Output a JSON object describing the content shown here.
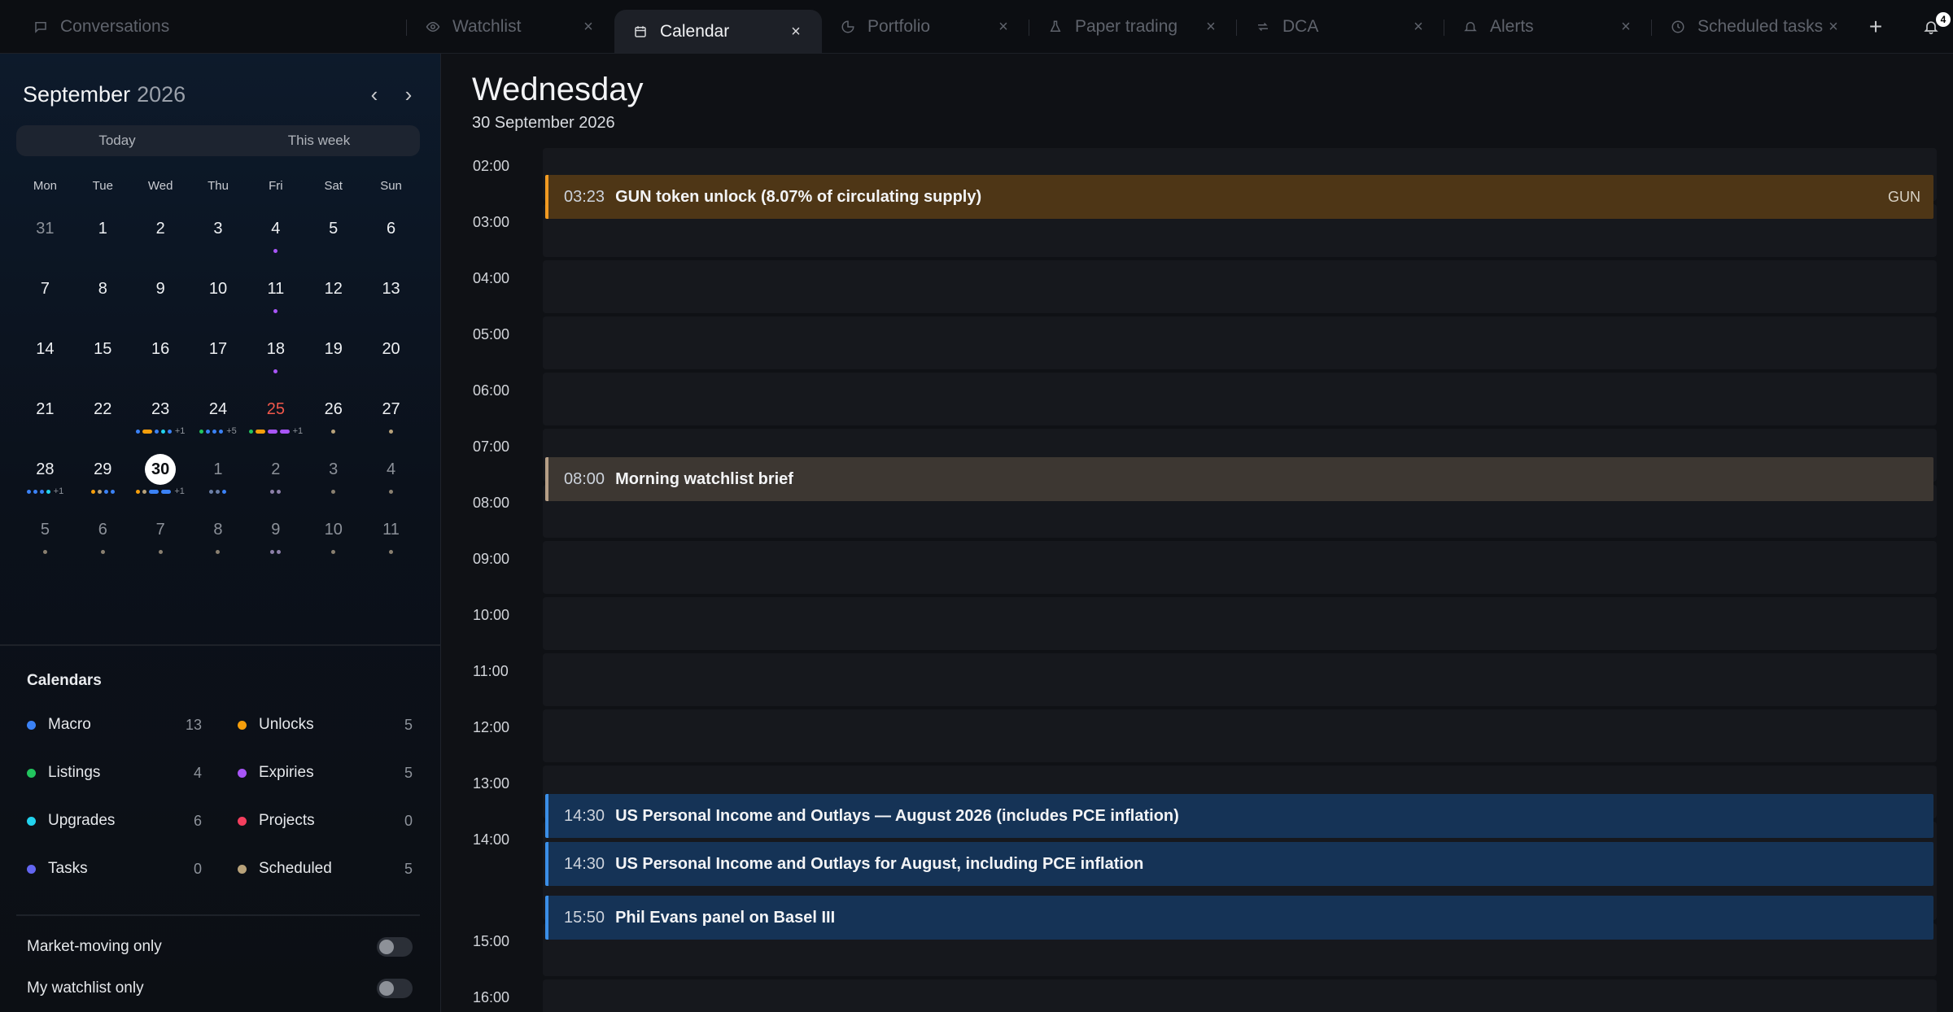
{
  "tabs": [
    {
      "label": "Conversations",
      "icon": "chat-icon"
    },
    {
      "label": "Watchlist",
      "icon": "eye-icon"
    },
    {
      "label": "Calendar",
      "icon": "calendar-icon",
      "active": true
    },
    {
      "label": "Portfolio",
      "icon": "pie-icon"
    },
    {
      "label": "Paper trading",
      "icon": "flask-icon"
    },
    {
      "label": "DCA",
      "icon": "repeat-icon"
    },
    {
      "label": "Alerts",
      "icon": "bell-icon"
    },
    {
      "label": "Scheduled tasks",
      "icon": "clock-icon"
    }
  ],
  "tab_close_glyph": "×",
  "header": {
    "add_glyph": "+",
    "notification_count": "4"
  },
  "sidebar": {
    "month": "September",
    "year": "2026",
    "prev_glyph": "‹",
    "next_glyph": "›",
    "today_label": "Today",
    "week_label": "This week",
    "weekdays": [
      "Mon",
      "Tue",
      "Wed",
      "Thu",
      "Fri",
      "Sat",
      "Sun"
    ],
    "days": [
      {
        "n": "31",
        "other": true,
        "dots": []
      },
      {
        "n": "1",
        "dots": []
      },
      {
        "n": "2",
        "dots": []
      },
      {
        "n": "3",
        "dots": []
      },
      {
        "n": "4",
        "dots": [
          "#a855f7"
        ]
      },
      {
        "n": "5",
        "dots": []
      },
      {
        "n": "6",
        "dots": []
      },
      {
        "n": "7",
        "dots": []
      },
      {
        "n": "8",
        "dots": []
      },
      {
        "n": "9",
        "dots": []
      },
      {
        "n": "10",
        "dots": []
      },
      {
        "n": "11",
        "dots": [
          "#a855f7"
        ]
      },
      {
        "n": "12",
        "dots": []
      },
      {
        "n": "13",
        "dots": []
      },
      {
        "n": "14",
        "dots": []
      },
      {
        "n": "15",
        "dots": []
      },
      {
        "n": "16",
        "dots": []
      },
      {
        "n": "17",
        "dots": []
      },
      {
        "n": "18",
        "dots": [
          "#a855f7"
        ]
      },
      {
        "n": "19",
        "dots": []
      },
      {
        "n": "20",
        "dots": []
      },
      {
        "n": "21",
        "dots": []
      },
      {
        "n": "22",
        "dots": []
      },
      {
        "n": "23",
        "dots": [
          "#3b82f6",
          "#f59e0b:w",
          "#3b82f6",
          "#22d3ee",
          "#3b82f6"
        ],
        "more": "+1"
      },
      {
        "n": "24",
        "dots": [
          "#22c55e",
          "#3b82f6",
          "#3b82f6",
          "#3b82f6"
        ],
        "more": "+5"
      },
      {
        "n": "25",
        "red": true,
        "dots": [
          "#22c55e",
          "#f59e0b:w",
          "#a855f7:w",
          "#a855f7:w"
        ],
        "more": "+1"
      },
      {
        "n": "26",
        "dots": [
          "#b8a27a"
        ]
      },
      {
        "n": "27",
        "dots": [
          "#b8a27a"
        ]
      },
      {
        "n": "28",
        "dots": [
          "#3b82f6",
          "#3b82f6",
          "#3b82f6",
          "#22d3ee"
        ],
        "more": "+1"
      },
      {
        "n": "29",
        "dots": [
          "#f59e0b",
          "#b8a27a",
          "#3b82f6",
          "#3b82f6"
        ]
      },
      {
        "n": "30",
        "today": true,
        "dots": [
          "#f59e0b",
          "#b8a27a",
          "#3b82f6:w",
          "#3b82f6:w"
        ],
        "more": "+1"
      },
      {
        "n": "1",
        "other": true,
        "dots": [
          "#6b7fa8",
          "#6b7fa8",
          "#3b82f6"
        ]
      },
      {
        "n": "2",
        "other": true,
        "dots": [
          "#8c7fa8",
          "#8c7fa8"
        ]
      },
      {
        "n": "3",
        "other": true,
        "dots": [
          "#8a8070"
        ]
      },
      {
        "n": "4",
        "other": true,
        "dots": [
          "#8a8070"
        ]
      },
      {
        "n": "5",
        "other": true,
        "dots": [
          "#8a8070"
        ]
      },
      {
        "n": "6",
        "other": true,
        "dots": [
          "#8a8070"
        ]
      },
      {
        "n": "7",
        "other": true,
        "dots": [
          "#8a8070"
        ]
      },
      {
        "n": "8",
        "other": true,
        "dots": [
          "#8a8070"
        ]
      },
      {
        "n": "9",
        "other": true,
        "dots": [
          "#8c7fa8",
          "#8c7fa8"
        ]
      },
      {
        "n": "10",
        "other": true,
        "dots": [
          "#8a8070"
        ]
      },
      {
        "n": "11",
        "other": true,
        "dots": [
          "#8a8070"
        ]
      }
    ],
    "calendars_title": "Calendars",
    "calendars": [
      {
        "label": "Macro",
        "count": "13",
        "color": "#3b82f6"
      },
      {
        "label": "Unlocks",
        "count": "5",
        "color": "#f59e0b"
      },
      {
        "label": "Listings",
        "count": "4",
        "color": "#22c55e"
      },
      {
        "label": "Expiries",
        "count": "5",
        "color": "#a855f7"
      },
      {
        "label": "Upgrades",
        "count": "6",
        "color": "#22d3ee"
      },
      {
        "label": "Projects",
        "count": "0",
        "color": "#f43f5e"
      },
      {
        "label": "Tasks",
        "count": "0",
        "color": "#6366f1"
      },
      {
        "label": "Scheduled",
        "count": "5",
        "color": "#b8a27a"
      }
    ],
    "toggles": [
      {
        "label": "Market-moving only"
      },
      {
        "label": "My watchlist only"
      }
    ]
  },
  "main": {
    "weekday": "Wednesday",
    "date": "30 September 2026",
    "hours": [
      "02:00",
      "03:00",
      "04:00",
      "05:00",
      "06:00",
      "07:00",
      "08:00",
      "09:00",
      "10:00",
      "11:00",
      "12:00",
      "13:00",
      "14:00",
      "15:00",
      "16:00"
    ],
    "events": [
      {
        "time": "03:23",
        "title": "GUN token unlock (8.07% of circulating supply)",
        "tag": "GUN",
        "kind": "unlock"
      },
      {
        "time": "08:00",
        "title": "Morning watchlist brief",
        "tag": "",
        "kind": "sched"
      },
      {
        "time": "14:30",
        "title": "US Personal Income and Outlays — August 2026 (includes PCE inflation)",
        "tag": "",
        "kind": "macro"
      },
      {
        "time": "14:30",
        "title": "US Personal Income and Outlays for August, including PCE inflation",
        "tag": "",
        "kind": "macro"
      },
      {
        "time": "15:50",
        "title": "Phil Evans panel on Basel III",
        "tag": "",
        "kind": "macro"
      }
    ]
  }
}
